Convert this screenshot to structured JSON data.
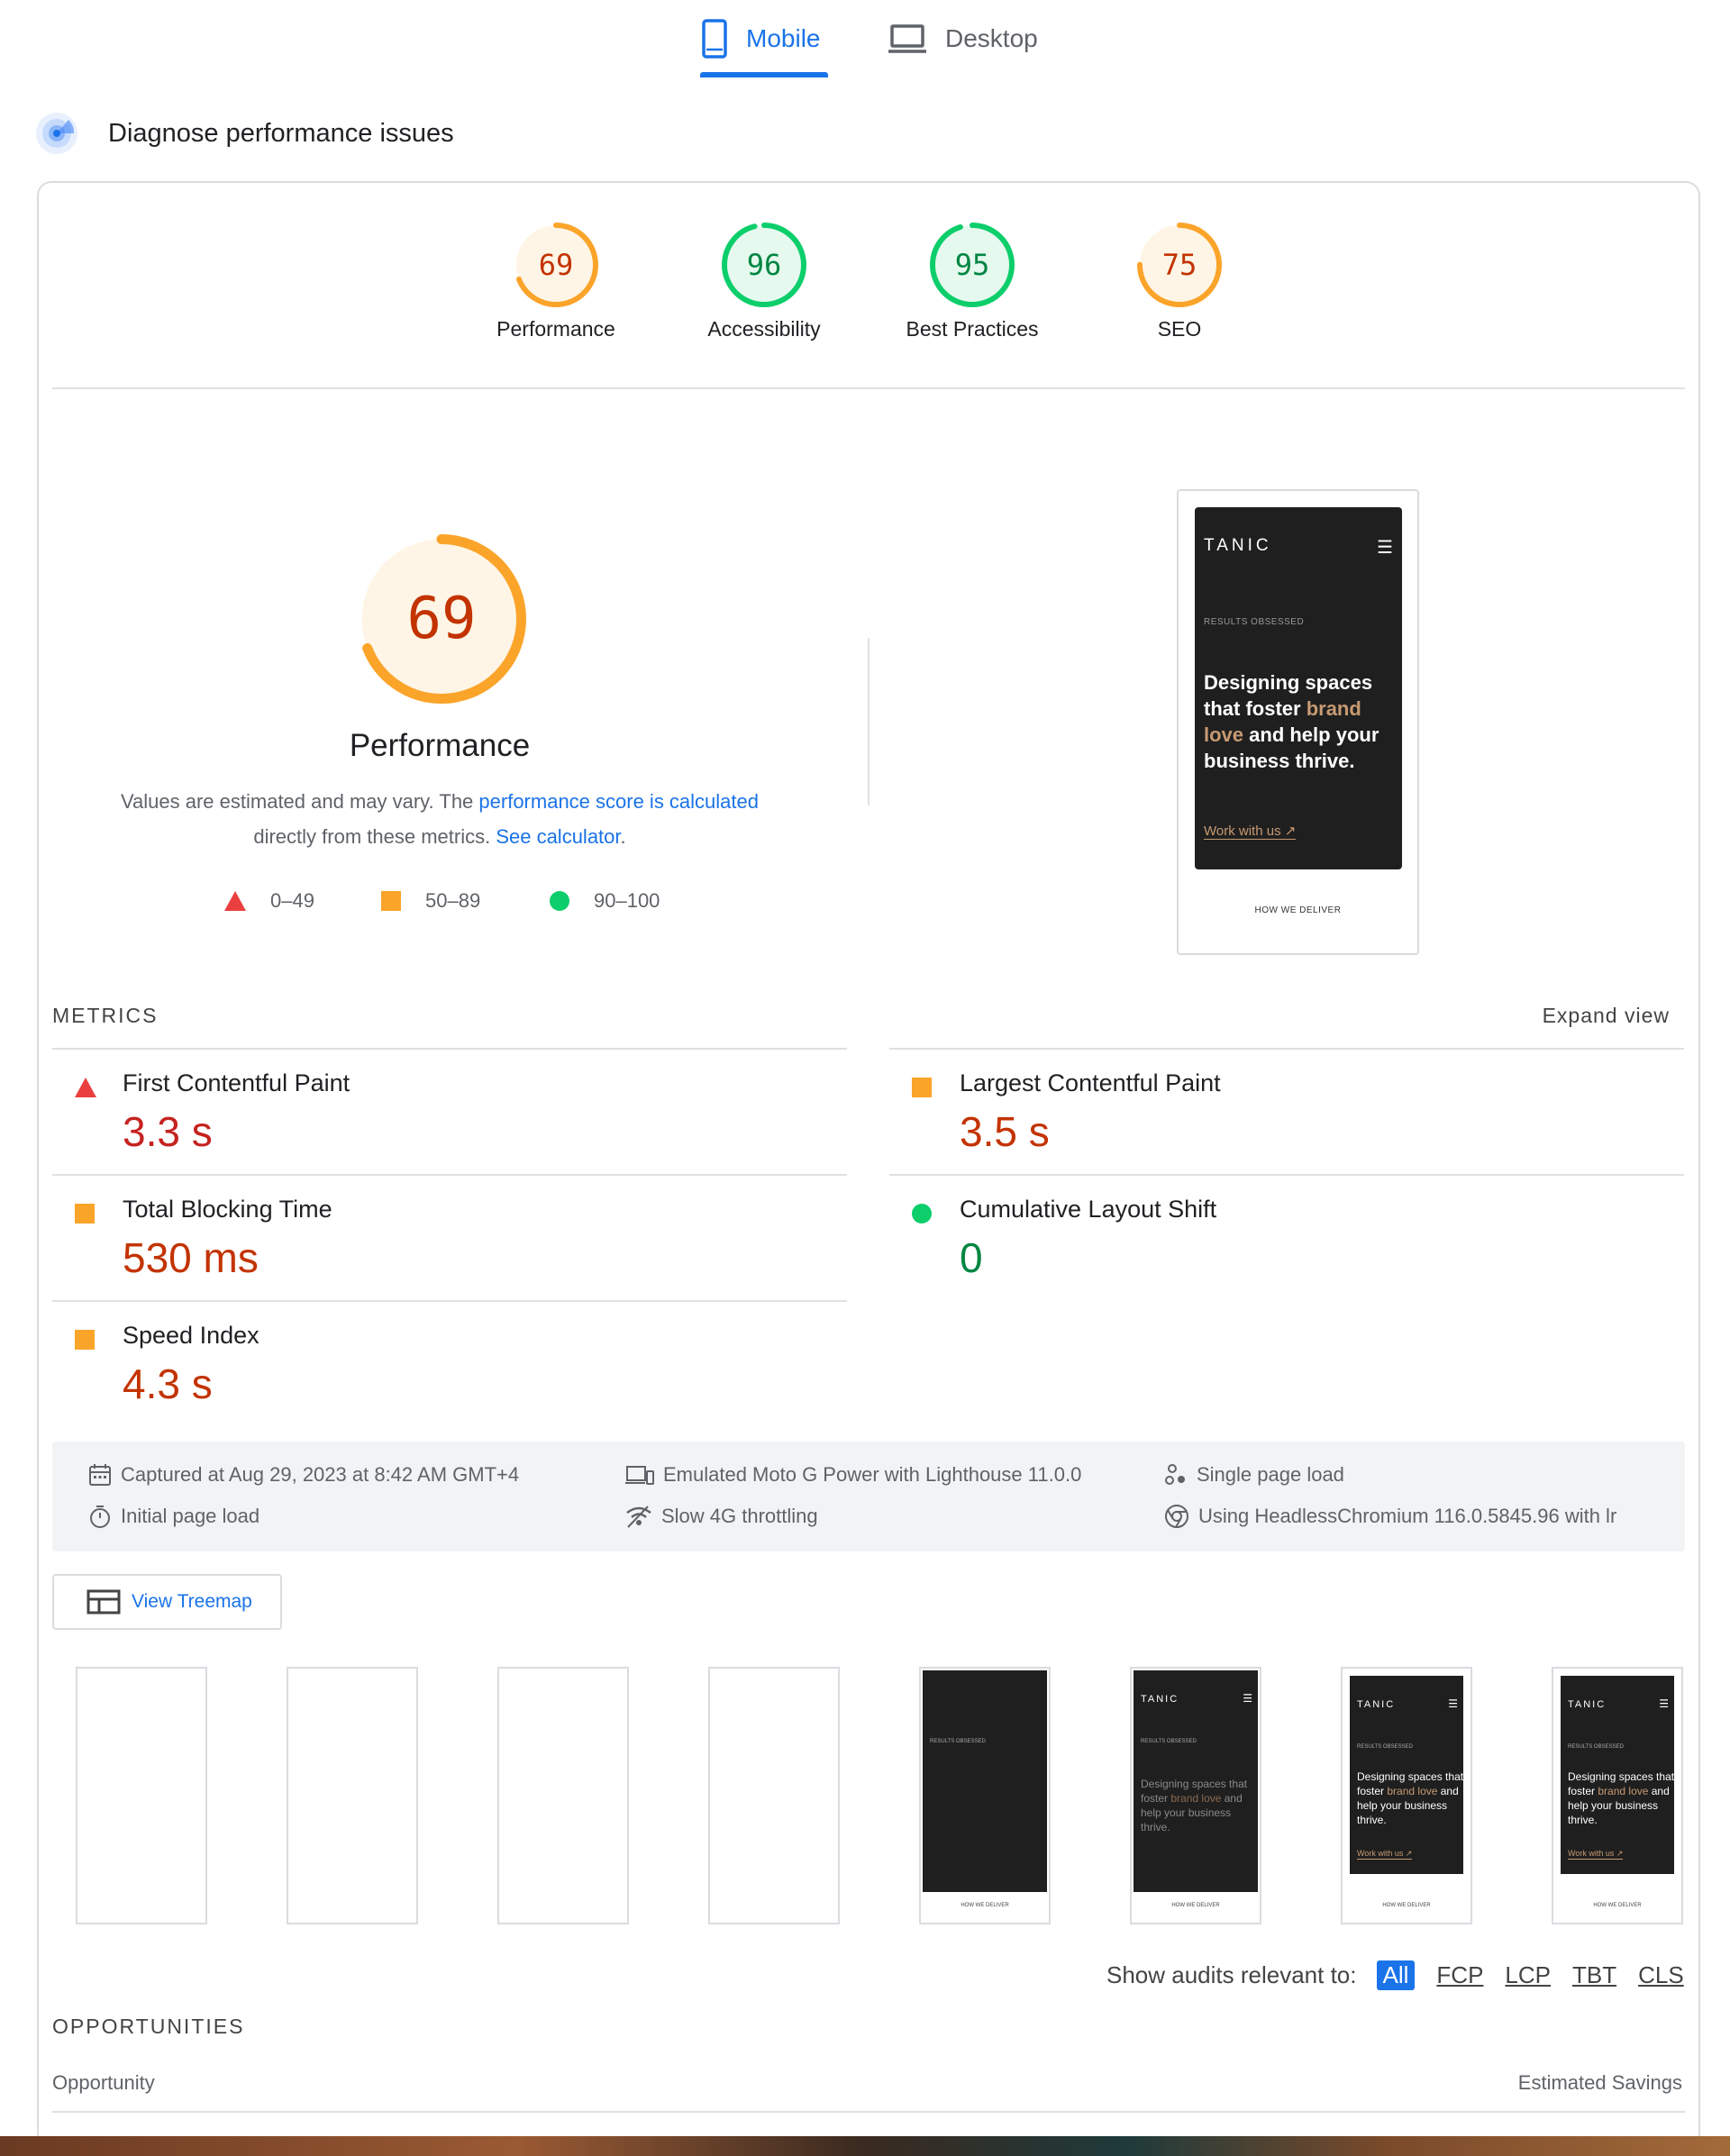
{
  "device_tabs": {
    "mobile_label": "Mobile",
    "desktop_label": "Desktop",
    "active": "mobile"
  },
  "diagnose_title": "Diagnose performance issues",
  "scores": [
    {
      "value": "69",
      "label": "Performance",
      "score": 69,
      "status": "average"
    },
    {
      "value": "96",
      "label": "Accessibility",
      "score": 96,
      "status": "pass"
    },
    {
      "value": "95",
      "label": "Best Practices",
      "score": 95,
      "status": "pass"
    },
    {
      "value": "75",
      "label": "SEO",
      "score": 75,
      "status": "average"
    }
  ],
  "performance": {
    "value": "69",
    "score": 69,
    "title": "Performance",
    "note_1": "Values are estimated and may vary. The ",
    "note_link_1": "performance score is calculated",
    "note_2": "directly from these metrics. ",
    "note_link_2": "See calculator",
    "note_3": "."
  },
  "legend": [
    {
      "range": "0–49",
      "shape": "triangle"
    },
    {
      "range": "50–89",
      "shape": "square"
    },
    {
      "range": "90–100",
      "shape": "circle"
    }
  ],
  "screenshot": {
    "brand": "TANIC",
    "menu_glyph": "☰",
    "tagline": "RESULTS OBSESSED",
    "hero_1": "Designing spaces that foster ",
    "hero_accent_1": "brand",
    "hero_2": " ",
    "hero_accent_2": "love",
    "hero_3": " and help your business thrive.",
    "cta": "Work with us ↗",
    "footer": "HOW WE DELIVER"
  },
  "metrics": {
    "section_label": "METRICS",
    "expand_label": "Expand view",
    "items": [
      {
        "name": "First Contentful Paint",
        "value": "3.3 s",
        "status": "fail"
      },
      {
        "name": "Largest Contentful Paint",
        "value": "3.5 s",
        "status": "average"
      },
      {
        "name": "Total Blocking Time",
        "value": "530 ms",
        "status": "average"
      },
      {
        "name": "Cumulative Layout Shift",
        "value": "0",
        "status": "pass"
      },
      {
        "name": "Speed Index",
        "value": "4.3 s",
        "status": "average"
      }
    ]
  },
  "environment": {
    "captured": "Captured at Aug 29, 2023 at 8:42 AM GMT+4",
    "initial_load": "Initial page load",
    "device": "Emulated Moto G Power with Lighthouse 11.0.0",
    "throttling": "Slow 4G throttling",
    "session": "Single page load",
    "browser": "Using HeadlessChromium 116.0.5845.96 with lr"
  },
  "treemap_label": "View Treemap",
  "audit_filter": {
    "label": "Show audits relevant to:",
    "chips": [
      "All",
      "FCP",
      "LCP",
      "TBT",
      "CLS"
    ],
    "active": "All"
  },
  "opportunities": {
    "section_label": "OPPORTUNITIES",
    "col_left": "Opportunity",
    "col_right": "Estimated Savings"
  },
  "colors": {
    "accent": "#1a73e8",
    "fail": "#eb3f3f",
    "fail_text": "#c5221f",
    "average": "#fba42a",
    "average_text": "#c33300",
    "pass": "#0cce6b",
    "pass_text": "#018642"
  },
  "icons": {
    "mobile_tab": "smartphone-icon",
    "desktop_tab": "laptop-icon",
    "diagnose": "lighthouse-gauge-icon",
    "captured": "calendar-icon",
    "initial_load": "stopwatch-icon",
    "device": "devices-icon",
    "throttling": "network-signal-icon",
    "session": "session-icon",
    "browser": "chromium-icon",
    "treemap": "treemap-icon"
  }
}
